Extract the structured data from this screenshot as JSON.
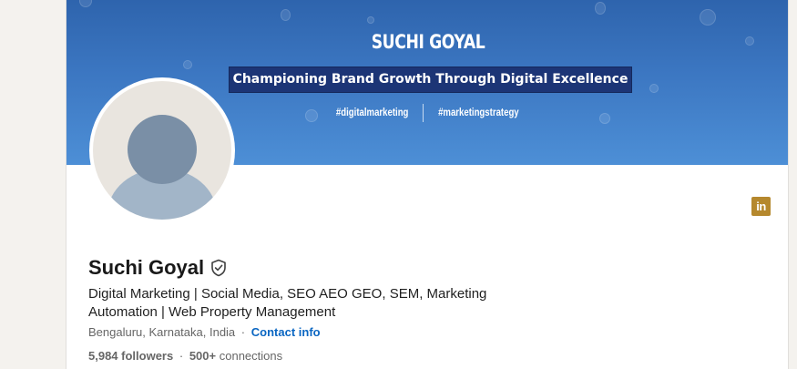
{
  "banner": {
    "title": "SUCHI GOYAL",
    "tagline": "Championing Brand Growth Through Digital Excellence",
    "hashtags": [
      "#digitalmarketing",
      "#marketingstrategy"
    ],
    "background_color": "#3c77c2",
    "tagline_box_color": "#1c3576"
  },
  "profile": {
    "name": "Suchi Goyal",
    "verified_icon": "shield-check-icon",
    "headline": "Digital Marketing | Social Media, SEO AEO GEO, SEM, Marketing Automation | Web Property Management",
    "location": "Bengaluru, Karnataka, India",
    "separator": "·",
    "contact_link": "Contact info",
    "followers_count": "5,984 followers",
    "connections_count": "500+",
    "connections_label": "connections"
  },
  "icons": {
    "linkedin_badge": "in",
    "linkedin_badge_color": "#b5882d"
  },
  "colors": {
    "link": "#0a66c2",
    "page_background": "#f4f2ee"
  }
}
